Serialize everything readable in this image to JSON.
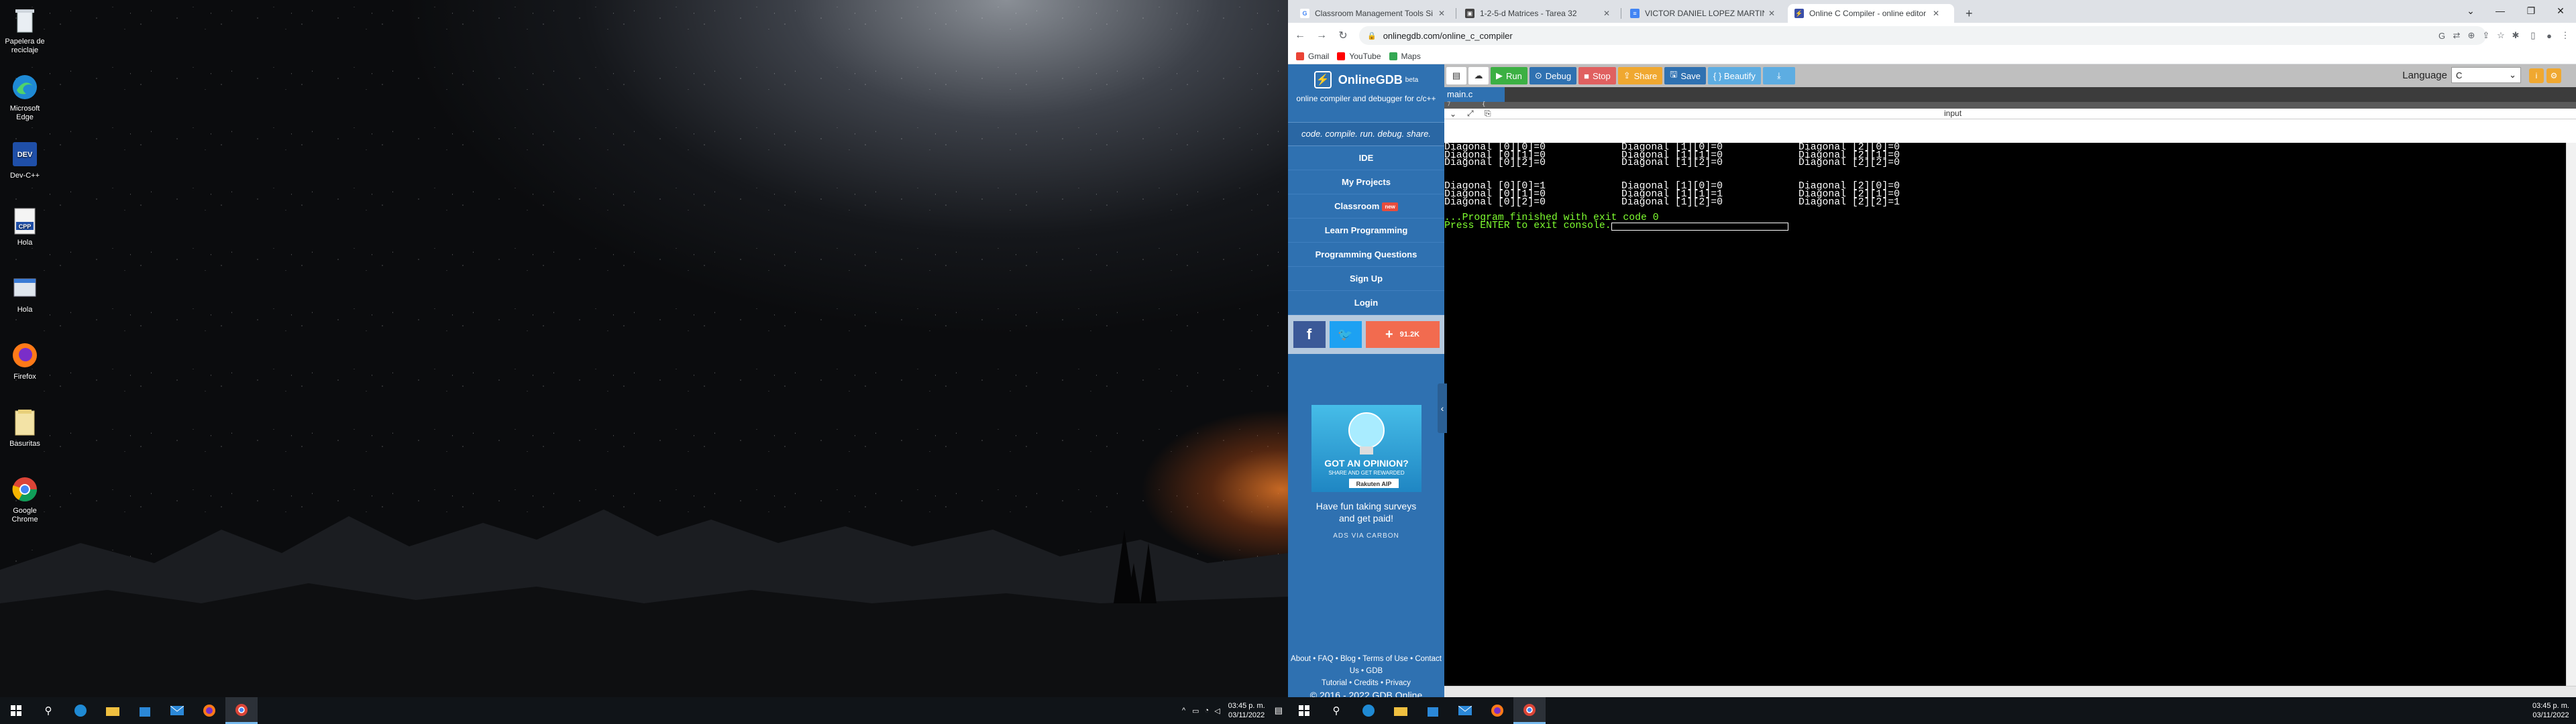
{
  "desktop": {
    "icons": [
      {
        "label": "Papelera de reciclaje",
        "icon": "recycle-bin-icon"
      },
      {
        "label": "Microsoft Edge",
        "icon": "edge-icon"
      },
      {
        "label": "Dev-C++",
        "icon": "devcpp-icon"
      },
      {
        "label": "Hola",
        "icon": "cpp-file-icon"
      },
      {
        "label": "Hola",
        "icon": "exe-file-icon"
      },
      {
        "label": "Firefox",
        "icon": "firefox-icon"
      },
      {
        "label": "Basuritas",
        "icon": "folder-icon"
      },
      {
        "label": "Google Chrome",
        "icon": "chrome-icon"
      }
    ]
  },
  "taskbar_left": {
    "time": "03:45 p. m.",
    "date": "03/11/2022"
  },
  "taskbar_right": {
    "time": "03:45 p. m.",
    "date": "03/11/2022"
  },
  "browser": {
    "tabs": [
      {
        "title": "Classroom Management Tools Si",
        "icon": "google-icon",
        "color": "#ffffff"
      },
      {
        "title": "1-2-5-d Matrices - Tarea 32",
        "icon": "classroom-icon",
        "color": "#444444"
      },
      {
        "title": "VICTOR DANIEL LOPEZ MARTINE",
        "icon": "docs-icon",
        "color": "#4285f4"
      },
      {
        "title": "Online C Compiler - online editor",
        "icon": "onlinegdb-icon",
        "color": "#3b4fa8"
      }
    ],
    "new_tab": "+",
    "url": "onlinegdb.com/online_c_compiler",
    "bookmarks": [
      {
        "label": "Gmail",
        "color": "#ea4335"
      },
      {
        "label": "YouTube",
        "color": "#ff0000"
      },
      {
        "label": "Maps",
        "color": "#34a853"
      }
    ]
  },
  "gdb": {
    "logo_name": "OnlineGDB",
    "logo_beta": "beta",
    "logo_sub": "online compiler and debugger for c/c++",
    "tagline": "code. compile. run. debug. share.",
    "nav": [
      "IDE",
      "My Projects",
      "Classroom",
      "Learn Programming",
      "Programming Questions",
      "Sign Up",
      "Login"
    ],
    "new_badge": "new",
    "share_count": "91.2K",
    "ad": {
      "headline_1": "GOT AN OPINION?",
      "headline_2": "SHARE AND GET REWARDED",
      "brand": "Rakuten AIP",
      "text_1": "Have fun taking surveys",
      "text_2": "and get paid!",
      "via": "ADS VIA CARBON"
    },
    "footer_links_1": "About • FAQ • Blog • Terms of Use • Contact Us • GDB",
    "footer_links_2": "Tutorial • Credits • Privacy",
    "copyright": "© 2016 - 2022 GDB Online"
  },
  "editor": {
    "buttons": {
      "run": "Run",
      "debug": "Debug",
      "stop": "Stop",
      "share": "Share",
      "save": "Save",
      "beautify": "{ } Beautify"
    },
    "colors": {
      "run": "#3cb043",
      "debug": "#2f71b1",
      "stop": "#e06060",
      "share": "#f0a830",
      "save": "#2f71b1",
      "beautify": "#5dade2",
      "download": "#5dade2"
    },
    "language_label": "Language",
    "language_value": "C",
    "file_tab": "main.c",
    "line_strip": "7",
    "console_input_label": "input",
    "console_lines": [
      [
        "Diagonal [0][0]=0",
        "Diagonal [1][0]=0",
        "Diagonal [2][0]=0"
      ],
      [
        "Diagonal [0][1]=0",
        "Diagonal [1][1]=0",
        "Diagonal [2][1]=0"
      ],
      [
        "Diagonal [0][2]=0",
        "Diagonal [1][2]=0",
        "Diagonal [2][2]=0"
      ],
      [
        "",
        "",
        ""
      ],
      [
        "",
        "",
        ""
      ],
      [
        "Diagonal [0][0]=1",
        "Diagonal [1][0]=0",
        "Diagonal [2][0]=0"
      ],
      [
        "Diagonal [0][1]=0",
        "Diagonal [1][1]=1",
        "Diagonal [2][1]=0"
      ],
      [
        "Diagonal [0][2]=0",
        "Diagonal [1][2]=0",
        "Diagonal [2][2]=1"
      ]
    ],
    "finish_line": "...Program finished with exit code 0",
    "press_line": "Press ENTER to exit console."
  }
}
